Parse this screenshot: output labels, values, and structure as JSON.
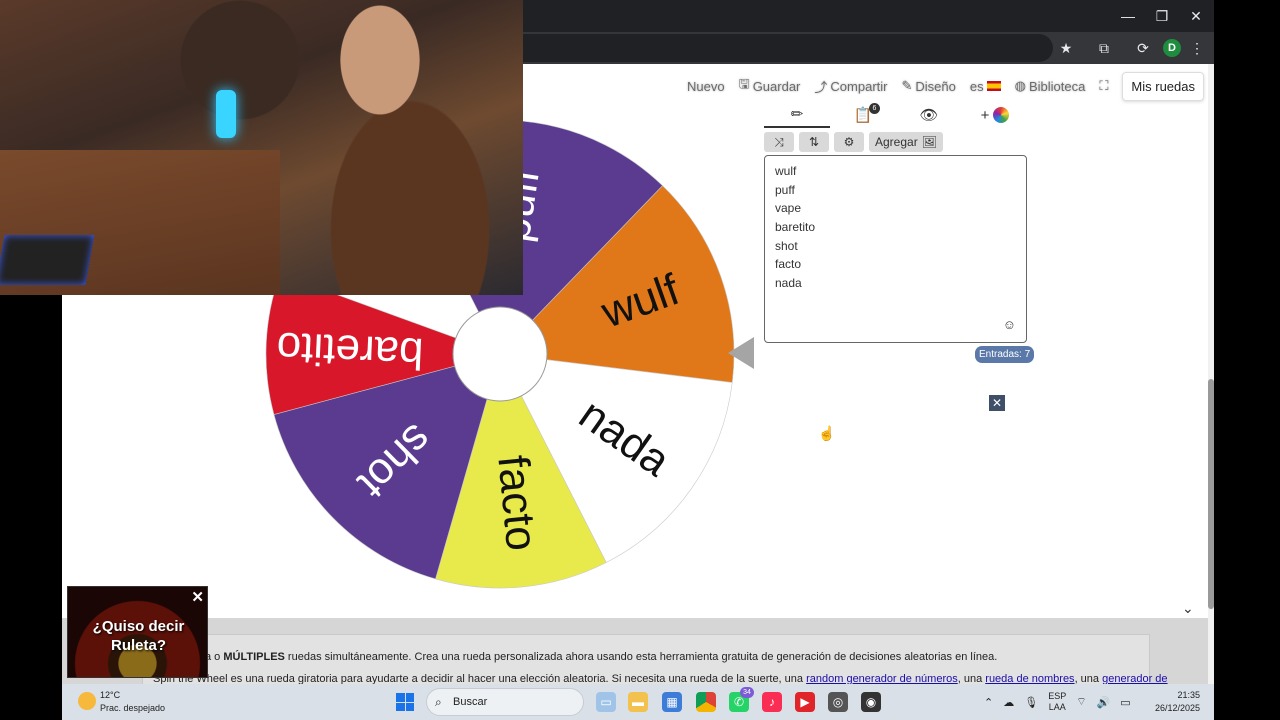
{
  "browser": {
    "minimize_icon": "minimize-icon",
    "restore_icon": "restore-icon",
    "close_icon": "close-icon",
    "profile_initial": "D"
  },
  "menu": {
    "nuevo": "Nuevo",
    "guardar": "Guardar",
    "compartir": "Compartir",
    "diseno": "Diseño",
    "lang": "es",
    "biblioteca": "Biblioteca",
    "mis_ruedas": "Mis ruedas"
  },
  "tabs": {
    "results_badge": "6"
  },
  "tools": {
    "agregar": "Agregar"
  },
  "entries": [
    "wulf",
    "puff",
    "vape",
    "baretito",
    "shot",
    "facto",
    "nada"
  ],
  "entries_count": "Entradas: 7",
  "wheel": {
    "segments": [
      {
        "label": "puff",
        "color": "#5a3b8f"
      },
      {
        "label": "wulf",
        "color": "#e0781a"
      },
      {
        "label": "nada",
        "color": "#ffffff"
      },
      {
        "label": "facto",
        "color": "#e8ea4c"
      },
      {
        "label": "shot",
        "color": "#5a3b8f"
      },
      {
        "label": "baretito",
        "color": "#d8182a"
      }
    ]
  },
  "ad": {
    "text_line1": "¿Quiso decir",
    "text_line2": "Ruleta?"
  },
  "description": {
    "line1_prefix": "a o ",
    "line1_bold": "MÚLTIPLES",
    "line1_rest": " ruedas simultáneamente. Crea una rueda personalizada ahora usando esta herramienta gratuita de generación de decisiones aleatorias en línea.",
    "line2_prefix": "Spin the Wheel es una rueda giratoria para ayudarte a decidir al hacer una elección aleatoria. Si necesita una rueda de la suerte, una ",
    "link1": "random generador de números",
    "line2_mid": ", una ",
    "link2": "rueda de nombres",
    "line2_mid2": ", una ",
    "link3": "generador de"
  },
  "taskbar": {
    "temp": "12°C",
    "weather": "Prac. despejado",
    "search": "Buscar",
    "whatsapp_badge": "34",
    "lang_top": "ESP",
    "lang_bottom": "LAA",
    "time": "21:35",
    "date": "26/12/2025"
  }
}
